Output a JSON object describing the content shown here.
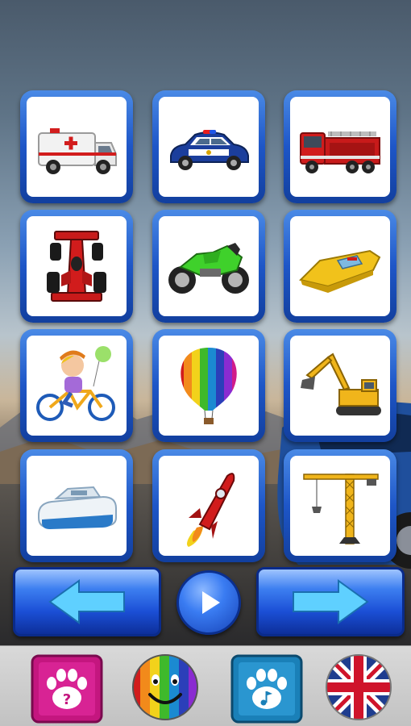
{
  "grid": {
    "items": [
      {
        "name": "ambulance",
        "icon": "ambulance-icon"
      },
      {
        "name": "police-car",
        "icon": "police-car-icon"
      },
      {
        "name": "fire-truck",
        "icon": "fire-truck-icon"
      },
      {
        "name": "race-car",
        "icon": "race-car-icon"
      },
      {
        "name": "motorcycle",
        "icon": "motorcycle-icon"
      },
      {
        "name": "speedboat",
        "icon": "speedboat-icon"
      },
      {
        "name": "bicycle",
        "icon": "bicycle-icon"
      },
      {
        "name": "hot-air-balloon",
        "icon": "hot-air-balloon-icon"
      },
      {
        "name": "excavator",
        "icon": "excavator-icon"
      },
      {
        "name": "hovercraft",
        "icon": "hovercraft-icon"
      },
      {
        "name": "rocket",
        "icon": "rocket-icon"
      },
      {
        "name": "tower-crane",
        "icon": "tower-crane-icon"
      }
    ]
  },
  "navigation": {
    "previous_icon": "left-arrow-icon",
    "play_icon": "play-icon",
    "next_icon": "right-arrow-icon"
  },
  "bottom_bar": {
    "buttons": [
      {
        "icon": "paw-question-icon",
        "color": "#c4167f"
      },
      {
        "icon": "rainbow-smiley-icon",
        "color": "#f2c200"
      },
      {
        "icon": "paw-music-icon",
        "color": "#1a80b8"
      },
      {
        "icon": "uk-flag-icon",
        "color": "#cf142b"
      }
    ]
  },
  "colors": {
    "tile_border": "#1e56c7",
    "nav_button": "#1b4fd6",
    "arrow_fill": "#5fd0ff"
  }
}
